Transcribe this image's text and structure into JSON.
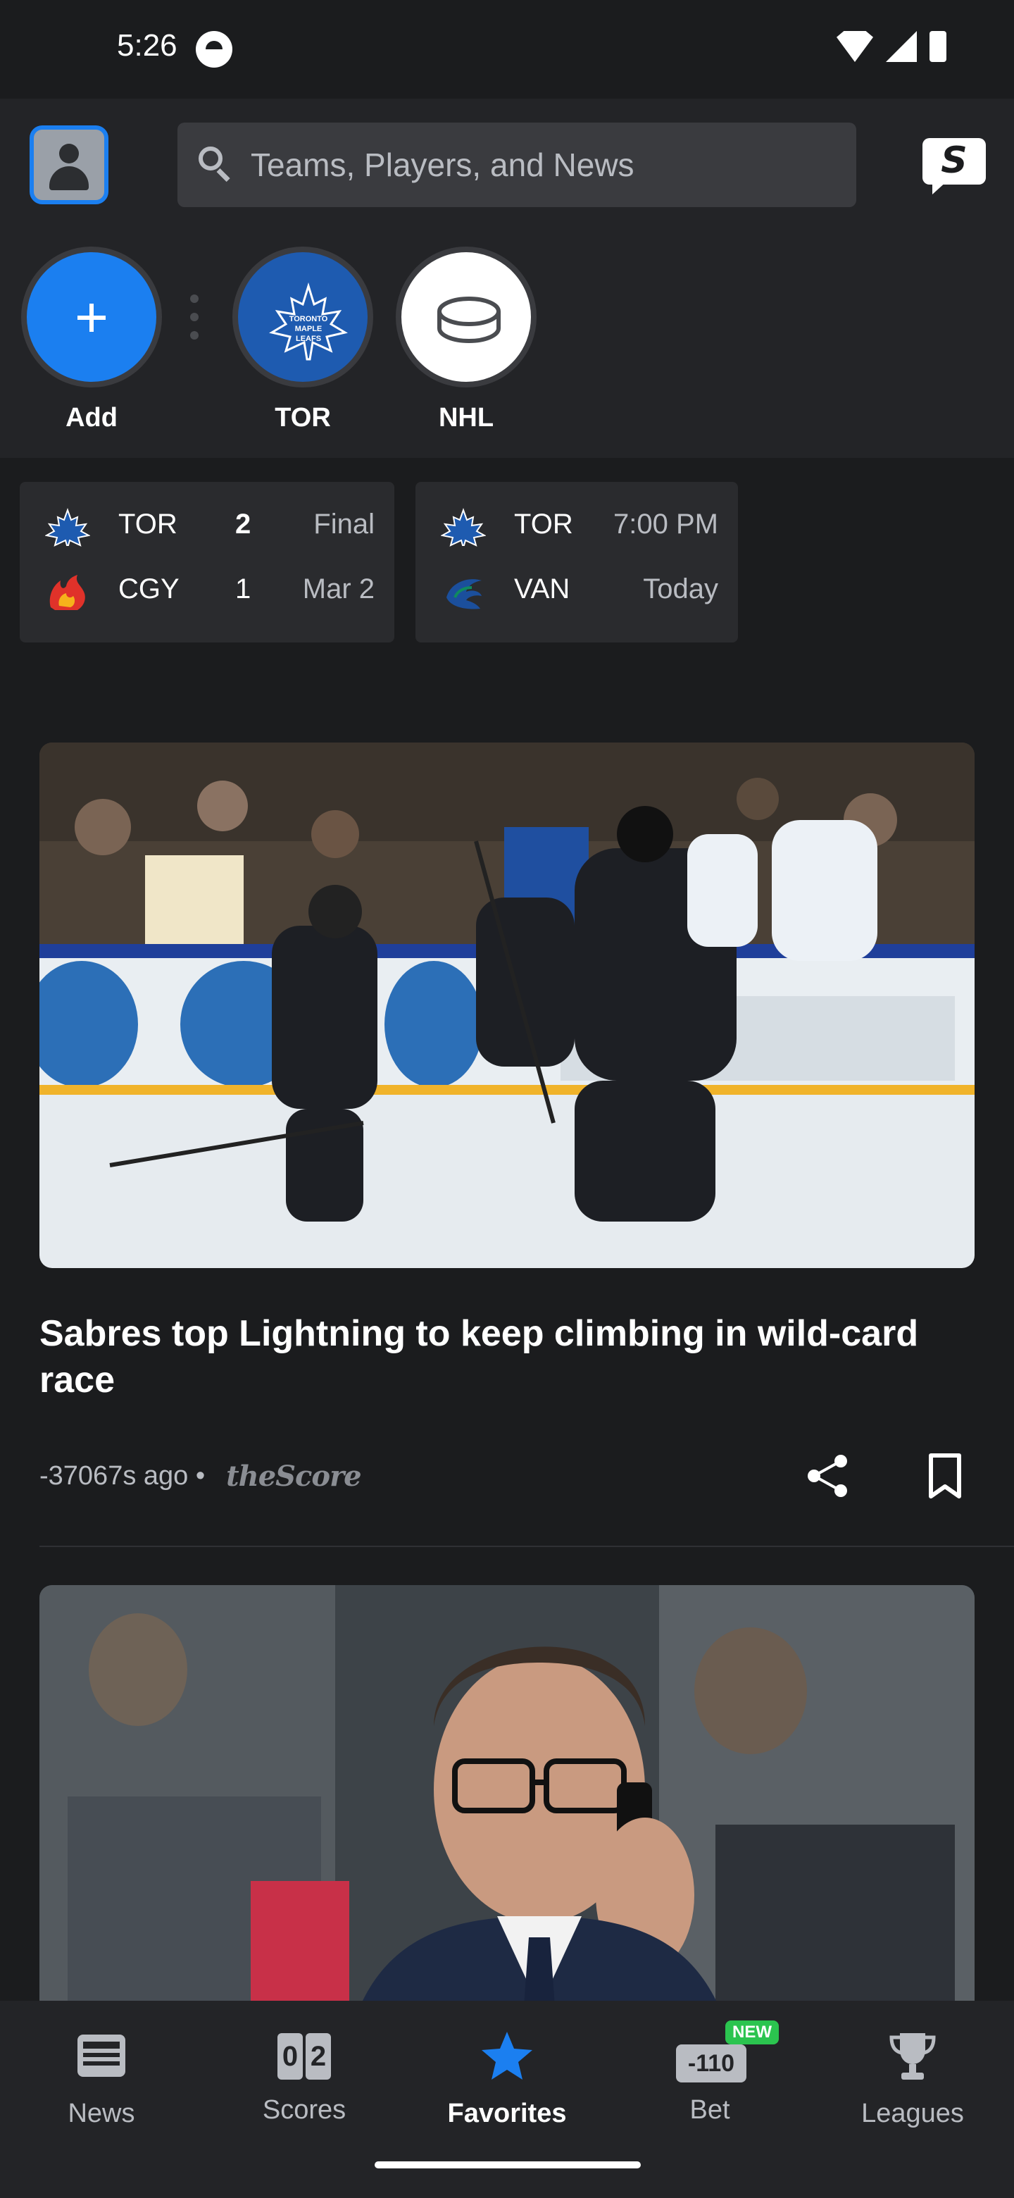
{
  "status_bar": {
    "time": "5:26",
    "icons": [
      "sync-icon",
      "wifi-icon",
      "cell-signal-icon",
      "battery-icon"
    ]
  },
  "header": {
    "profile_icon": "person-icon",
    "search_placeholder": "Teams, Players, and News",
    "chat_icon": "thescore-chat-icon"
  },
  "favorites": [
    {
      "label": "Add",
      "icon": "plus-icon"
    },
    {
      "label": "TOR",
      "icon": "maple-leafs-logo"
    },
    {
      "label": "NHL",
      "icon": "puck-icon"
    }
  ],
  "games": [
    {
      "teams": [
        {
          "abbr": "TOR",
          "score": "2",
          "logo": "maple-leafs-logo",
          "winner": true
        },
        {
          "abbr": "CGY",
          "score": "1",
          "logo": "flames-logo",
          "winner": false
        }
      ],
      "status_top": "Final",
      "status_bottom": "Mar 2"
    },
    {
      "teams": [
        {
          "abbr": "TOR",
          "score": "",
          "logo": "maple-leafs-logo"
        },
        {
          "abbr": "VAN",
          "score": "",
          "logo": "canucks-logo"
        }
      ],
      "status_top": "7:00 PM",
      "status_bottom": "Today"
    }
  ],
  "stories": [
    {
      "title": "Sabres top Lightning to keep climbing in wild-card race",
      "time_ago": "-37067s ago •",
      "source": "theScore",
      "image_description_icon": "hockey-celebration-photo"
    },
    {
      "image_description_icon": "executive-on-phone-photo"
    }
  ],
  "bottom_nav": {
    "items": [
      {
        "label": "News",
        "icon": "news-icon"
      },
      {
        "label": "Scores",
        "icon": "scores-icon",
        "icon_text_1": "0",
        "icon_text_2": "2"
      },
      {
        "label": "Favorites",
        "icon": "star-icon",
        "active": true
      },
      {
        "label": "Bet",
        "icon": "bet-icon",
        "icon_text": "-110",
        "badge": "NEW"
      },
      {
        "label": "Leagues",
        "icon": "trophy-icon"
      }
    ]
  },
  "colors": {
    "background": "#1b1c1e",
    "header": "#232427",
    "accent_blue": "#1b7ff0",
    "card": "#2a2b2e",
    "badge_green": "#2bc44f"
  }
}
